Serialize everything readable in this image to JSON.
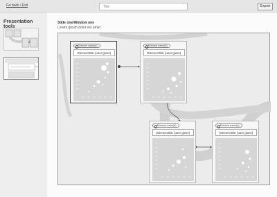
{
  "topbar": {
    "back_label": "Go back / Exit",
    "title_placeholder": "Title",
    "export_label": "Export"
  },
  "sidebar": {
    "title": "Presentation tools"
  },
  "main": {
    "slide_title": "Slide one/Window one",
    "slide_subtitle": "Lorem ipsum dolor set amet"
  },
  "cards": [
    {
      "tag": "Element name(#)",
      "title": "Element title (user given)",
      "selected": true
    },
    {
      "tag": "Element name(#)",
      "title": "Element title (user given)",
      "selected": false
    },
    {
      "tag": "Element name(#)",
      "title": "Element title (user given)",
      "selected": false
    },
    {
      "tag": "Element name(#)",
      "title": "Element title (user given)",
      "selected": false
    }
  ],
  "colors": {
    "topbar_bg": "#e6e6e6",
    "canvas_bg": "#ececec",
    "plot_bg": "#d6d6d6",
    "flow_band": "#d0d0d0"
  }
}
